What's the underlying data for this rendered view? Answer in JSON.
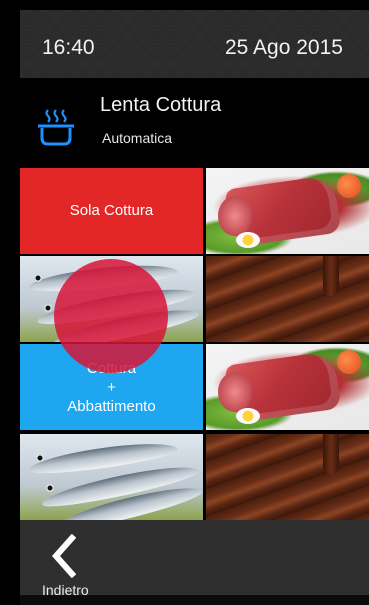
{
  "status_bar": {
    "time": "16:40",
    "date": "25 Ago 2015"
  },
  "header": {
    "icon": "pot-steam-icon",
    "title": "Lenta Cottura",
    "subtitle": "Automatica"
  },
  "tiles": {
    "sola_cottura": {
      "label": "Sola Cottura"
    },
    "cottura_abbattimento": {
      "line1": "Cottura",
      "line2": "+",
      "line3": "Abbattimento"
    }
  },
  "footer": {
    "back_label": "Indietro",
    "back_icon": "chevron-left-icon"
  },
  "colors": {
    "red": "#e32727",
    "blue": "#1ea6f0",
    "touch_highlight": "#d71437"
  }
}
